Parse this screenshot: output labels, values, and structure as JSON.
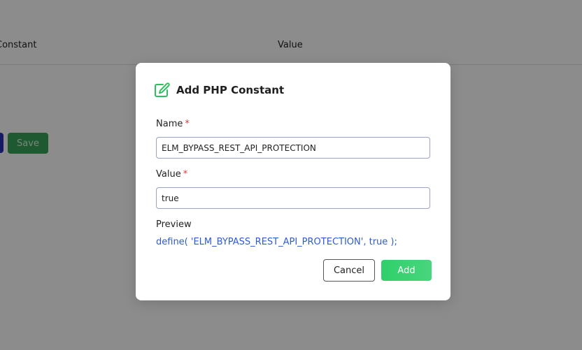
{
  "background": {
    "table_headers": [
      "Constant",
      "Value"
    ],
    "save_label": "Save"
  },
  "modal": {
    "title": "Add PHP Constant",
    "title_icon": "edit-icon",
    "name_label": "Name",
    "name_value": "ELM_BYPASS_REST_API_PROTECTION",
    "value_label": "Value",
    "value_value": "true",
    "required_marker": "*",
    "preview_label": "Preview",
    "preview_code": "define( 'ELM_BYPASS_REST_API_PROTECTION', true );",
    "cancel_label": "Cancel",
    "add_label": "Add"
  },
  "colors": {
    "accent_green": "#2fcf6a",
    "required_red": "#e23a3a",
    "preview_blue": "#2e5bd0"
  }
}
